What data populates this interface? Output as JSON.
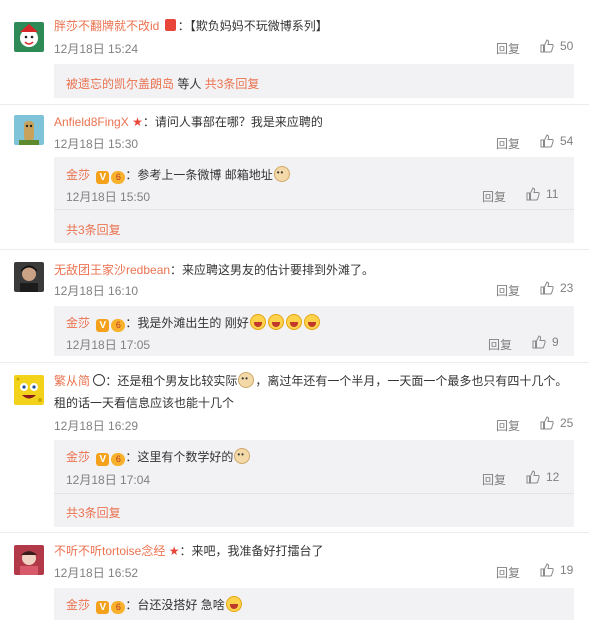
{
  "comments": [
    {
      "user": "胖莎不翻牌就不改id",
      "text": "：【欺负妈妈不玩微博系列】",
      "time": "12月18日 15:24",
      "reply": "回复",
      "likes": "50",
      "more": {
        "user": "被遗忘的凯尔盖朗岛",
        "mid": " 等人 ",
        "count": "共3条回复"
      }
    },
    {
      "user": "Anfield8FingX",
      "text": "：请问人事部在哪？我是来应聘的",
      "time": "12月18日 15:30",
      "reply": "回复",
      "likes": "54",
      "sub": {
        "user": "金莎",
        "text": "：参考上一条微博 邮箱地址",
        "time": "12月18日 15:50",
        "reply": "回复",
        "likes": "11"
      },
      "more": {
        "count": "共3条回复"
      }
    },
    {
      "user": "无敌团王家沙redbean",
      "text": "：来应聘这男友的估计要排到外滩了。",
      "time": "12月18日 16:10",
      "reply": "回复",
      "likes": "23",
      "sub": {
        "user": "金莎",
        "text": "：我是外滩出生的 刚好",
        "time": "12月18日 17:05",
        "reply": "回复",
        "likes": "9"
      }
    },
    {
      "user": "繁从简",
      "text1": "：还是租个男友比较实际",
      "text2": "，离过年还有一个半月，一天面一个最多也只有四十几个。",
      "text3": "租的话一天看信息应该也能十几个",
      "time": "12月18日 16:29",
      "reply": "回复",
      "likes": "25",
      "sub": {
        "user": "金莎",
        "text": "：这里有个数学好的",
        "time": "12月18日 17:04",
        "reply": "回复",
        "likes": "12"
      },
      "more": {
        "count": "共3条回复"
      }
    },
    {
      "user": "不听不听tortoise念经",
      "text": "：来吧，我准备好打擂台了",
      "time": "12月18日 16:52",
      "reply": "回复",
      "likes": "19",
      "sub": {
        "user": "金莎",
        "text": "：台还没搭好 急啥"
      }
    }
  ],
  "icons": {
    "like": "thumbs-up-icon",
    "star": "red-star-icon",
    "vip": "v-badge-icon"
  },
  "colors": {
    "username": "#eb7350",
    "subbox": "#f2f2f5",
    "meta": "#808080"
  }
}
